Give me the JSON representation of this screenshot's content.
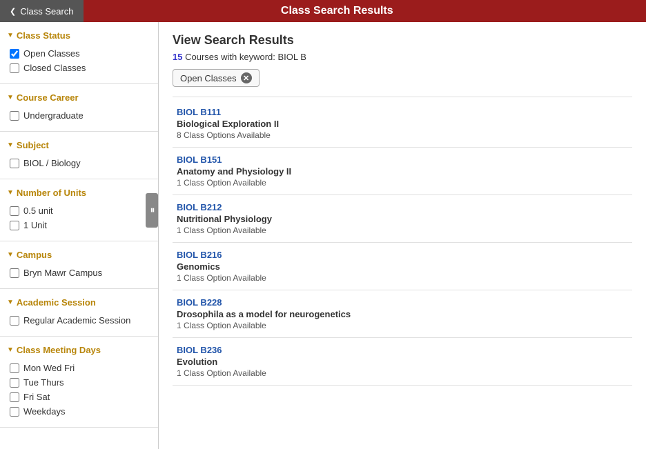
{
  "header": {
    "back_label": "Class Search",
    "title": "Class Search Results",
    "arrow": "❮"
  },
  "sidebar": {
    "sections": [
      {
        "id": "class-status",
        "title": "Class Status",
        "items": [
          {
            "label": "Open Classes",
            "checked": true
          },
          {
            "label": "Closed Classes",
            "checked": false
          }
        ]
      },
      {
        "id": "course-career",
        "title": "Course Career",
        "items": [
          {
            "label": "Undergraduate",
            "checked": false
          }
        ]
      },
      {
        "id": "subject",
        "title": "Subject",
        "items": [
          {
            "label": "BIOL / Biology",
            "checked": false
          }
        ]
      },
      {
        "id": "number-of-units",
        "title": "Number of Units",
        "items": [
          {
            "label": "0.5 unit",
            "checked": false
          },
          {
            "label": "1 Unit",
            "checked": false
          }
        ]
      },
      {
        "id": "campus",
        "title": "Campus",
        "items": [
          {
            "label": "Bryn Mawr Campus",
            "checked": false
          }
        ]
      },
      {
        "id": "academic-session",
        "title": "Academic Session",
        "items": [
          {
            "label": "Regular Academic Session",
            "checked": false
          }
        ]
      },
      {
        "id": "class-meeting-days",
        "title": "Class Meeting Days",
        "items": [
          {
            "label": "Mon Wed Fri",
            "checked": false
          },
          {
            "label": "Tue Thurs",
            "checked": false
          },
          {
            "label": "Fri Sat",
            "checked": false
          },
          {
            "label": "Weekdays",
            "checked": false
          }
        ]
      }
    ]
  },
  "content": {
    "view_title": "View Search Results",
    "result_count": "15",
    "result_keyword": "Courses with keyword: BIOL B",
    "active_filter": "Open Classes",
    "courses": [
      {
        "code": "BIOL B111",
        "name": "Biological Exploration II",
        "options": "8 Class Options Available"
      },
      {
        "code": "BIOL B151",
        "name": "Anatomy and Physiology II",
        "options": "1 Class Option Available"
      },
      {
        "code": "BIOL B212",
        "name": "Nutritional Physiology",
        "options": "1 Class Option Available"
      },
      {
        "code": "BIOL B216",
        "name": "Genomics",
        "options": "1 Class Option Available"
      },
      {
        "code": "BIOL B228",
        "name": "Drosophila as a model for neurogenetics",
        "options": "1 Class Option Available"
      },
      {
        "code": "BIOL B236",
        "name": "Evolution",
        "options": "1 Class Option Available"
      }
    ]
  }
}
